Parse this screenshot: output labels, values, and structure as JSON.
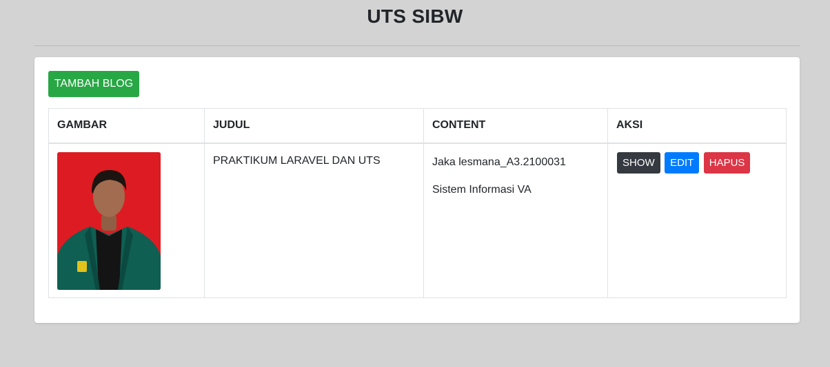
{
  "page": {
    "title": "UTS SIBW"
  },
  "toolbar": {
    "add_label": "TAMBAH BLOG",
    "add_color": "#28a745"
  },
  "table": {
    "headers": [
      "GAMBAR",
      "JUDUL",
      "CONTENT",
      "AKSI"
    ],
    "rows": [
      {
        "image": "student-photo",
        "judul": "PRAKTIKUM LARAVEL DAN UTS",
        "content": [
          "Jaka lesmana_A3.2100031",
          "Sistem Informasi VA"
        ],
        "actions": {
          "show": "SHOW",
          "edit": "EDIT",
          "hapus": "HAPUS"
        }
      }
    ]
  },
  "colors": {
    "background": "#d3d3d3",
    "show": "#343a40",
    "edit": "#007bff",
    "hapus": "#dc3545",
    "photo_bg": "#dc1c22"
  }
}
